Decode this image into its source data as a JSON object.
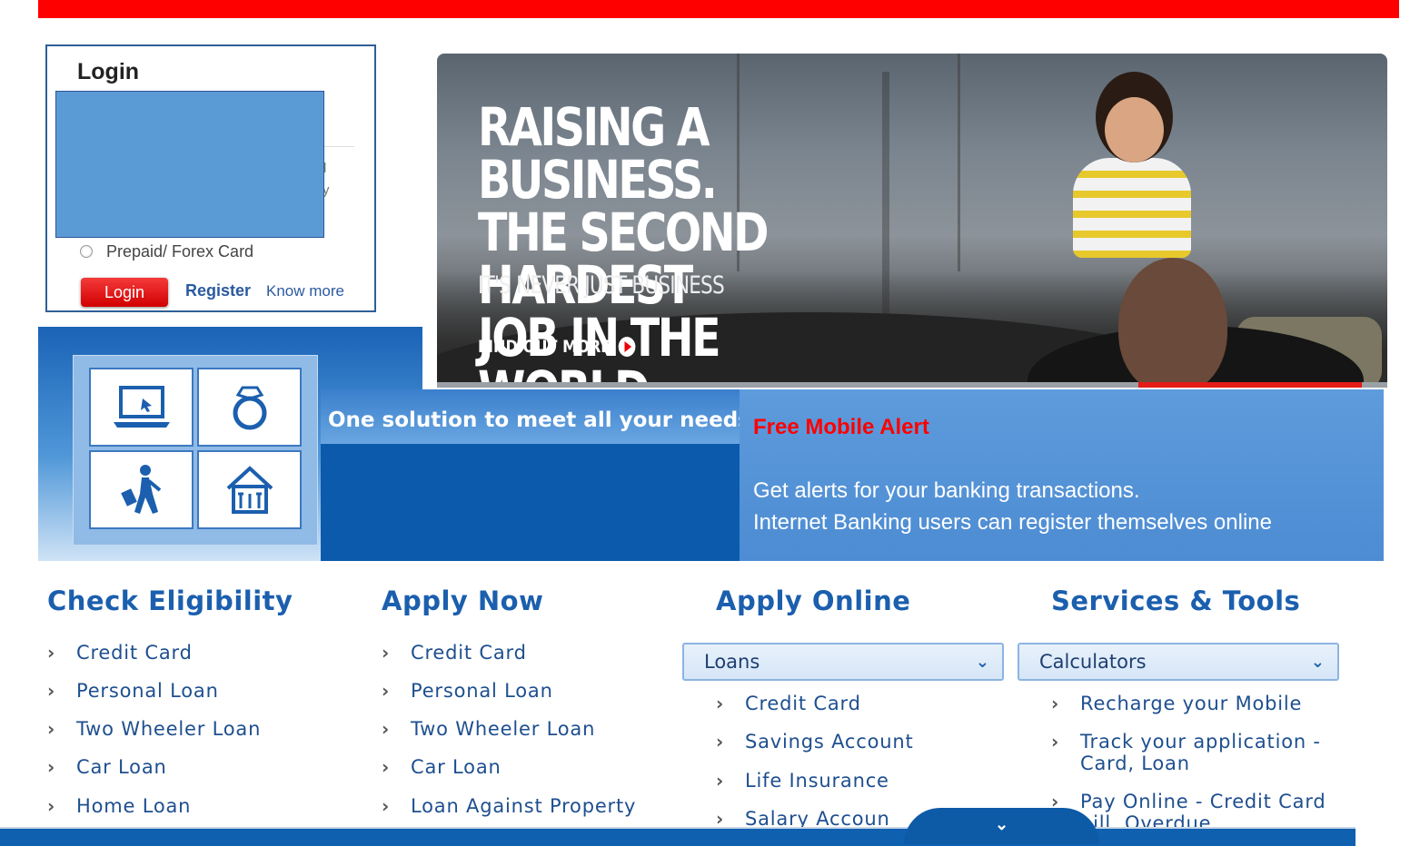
{
  "colors": {
    "brand_red": "#ff0000",
    "brand_blue": "#1b5fae",
    "alert_red": "#ff0000"
  },
  "login": {
    "title": "Login",
    "peek_fragment_1": "d",
    "peek_fragment_2": "y",
    "radio_prepaid_label": "Prepaid/ Forex Card",
    "login_button": "Login",
    "register_link": "Register",
    "know_more_link": "Know more"
  },
  "hero": {
    "headline_1": "RAISING A BUSINESS.",
    "headline_2": "THE SECOND HARDEST",
    "headline_3": "JOB IN THE WORLD.",
    "tagline": "IT'S NEVER JUST BUSINESS",
    "cta": "FIND OUT MORE"
  },
  "promo": {
    "tile_icons": [
      "laptop-icon",
      "ring-icon",
      "traveller-icon",
      "home-tools-icon"
    ],
    "heading": "One solution to meet all your needs"
  },
  "alert": {
    "title": "Free Mobile Alert",
    "line1": "Get alerts for your banking transactions.",
    "line2": "Internet Banking users can register themselves online"
  },
  "columns": {
    "check_eligibility": {
      "heading": "Check Eligibility",
      "items": [
        "Credit Card",
        "Personal Loan",
        "Two Wheeler Loan",
        "Car Loan",
        "Home Loan"
      ]
    },
    "apply_now": {
      "heading": "Apply Now",
      "items": [
        "Credit Card",
        "Personal Loan",
        "Two Wheeler Loan",
        "Car Loan",
        "Loan Against Property"
      ]
    },
    "apply_online": {
      "heading": "Apply Online",
      "dropdown": "Loans",
      "items": [
        "Credit Card",
        "Savings Account",
        "Life Insurance",
        "Salary Accoun"
      ]
    },
    "services_tools": {
      "heading": "Services & Tools",
      "dropdown": "Calculators",
      "items": [
        "Recharge your Mobile",
        "Track your application - Card, Loan",
        "Pay Online - Credit Card bill, Overdue"
      ]
    }
  },
  "bottom": {
    "expand_icon": "chevron-down-icon"
  }
}
